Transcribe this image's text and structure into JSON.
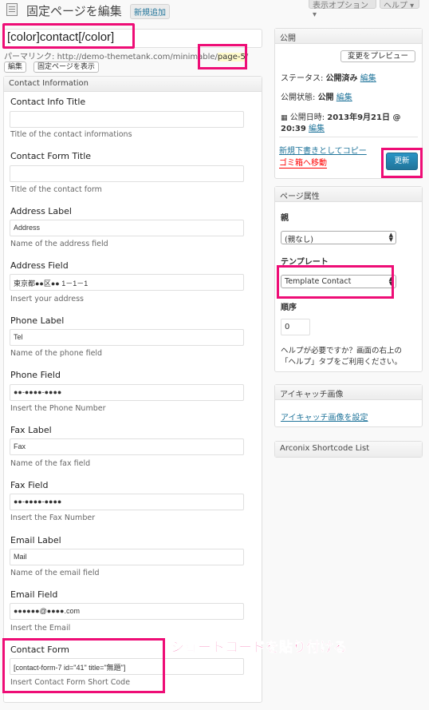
{
  "header": {
    "title": "固定ページを編集",
    "add_new": "新規追加",
    "screen_options": "表示オプション ▾",
    "help": "ヘルプ ▾"
  },
  "post": {
    "title_value": "[color]contact[/color]",
    "permalink_label": "パーマリンク:",
    "permalink_base": "http://demo-themetank.com/minimable/",
    "permalink_slug": "page-5",
    "permalink_tail": "/",
    "edit_button": "編集",
    "view_button": "固定ページを表示"
  },
  "contact_box": {
    "title": "Contact Information",
    "fields": [
      {
        "label": "Contact Info Title",
        "value": "",
        "desc": "Title of the contact informations"
      },
      {
        "label": "Contact Form Title",
        "value": "",
        "desc": "Title of the contact form"
      },
      {
        "label": "Address Label",
        "value": "Address",
        "desc": "Name of the address field"
      },
      {
        "label": "Address Field",
        "value": "東京都●●区●● 1－1－1",
        "desc": "Insert your address"
      },
      {
        "label": "Phone Label",
        "value": "Tel",
        "desc": "Name of the phone field"
      },
      {
        "label": "Phone Field",
        "value": "●●-●●●●-●●●●",
        "desc": "Insert the Phone Number"
      },
      {
        "label": "Fax Label",
        "value": "Fax",
        "desc": "Name of the fax field"
      },
      {
        "label": "Fax Field",
        "value": "●●-●●●●-●●●●",
        "desc": "Insert the Fax Number"
      },
      {
        "label": "Email Label",
        "value": "Mail",
        "desc": "Name of the email field"
      },
      {
        "label": "Email Field",
        "value": "●●●●●●@●●●●.com",
        "desc": "Insert the Email"
      },
      {
        "label": "Contact Form",
        "value": "[contact-form-7 id=\"41\" title=\"無題\"]",
        "desc": "Insert Contact Form Short Code"
      }
    ]
  },
  "annotation": {
    "callout": "ショートコードを貼り付ける"
  },
  "publish_box": {
    "title": "公開",
    "preview_button": "変更をプレビュー",
    "status_label": "ステータス:",
    "status_value": "公開済み",
    "status_edit": "編集",
    "visibility_label": "公開状態:",
    "visibility_value": "公開",
    "visibility_edit": "編集",
    "date_label": "公開日時:",
    "date_value": "2013年9月21日 @",
    "time_value": "20:39",
    "date_edit": "編集",
    "copy_draft": "新規下書きとしてコピー",
    "trash": "ゴミ箱へ移動",
    "update_button": "更新"
  },
  "attributes_box": {
    "title": "ページ属性",
    "parent_label": "親",
    "parent_value": "(親なし)",
    "template_label": "テンプレート",
    "template_value": "Template Contact",
    "order_label": "順序",
    "order_value": "0",
    "help_line1": "ヘルプが必要ですか？画面の右上の",
    "help_line2": "「ヘルプ」タブをご利用ください。"
  },
  "featured_box": {
    "title": "アイキャッチ画像",
    "link": "アイキャッチ画像を設定"
  },
  "shortcode_box": {
    "title": "Arconix Shortcode List"
  },
  "colors": {
    "highlight": "#ee0d76",
    "link": "#21759b",
    "primary_button": "#21759b"
  }
}
